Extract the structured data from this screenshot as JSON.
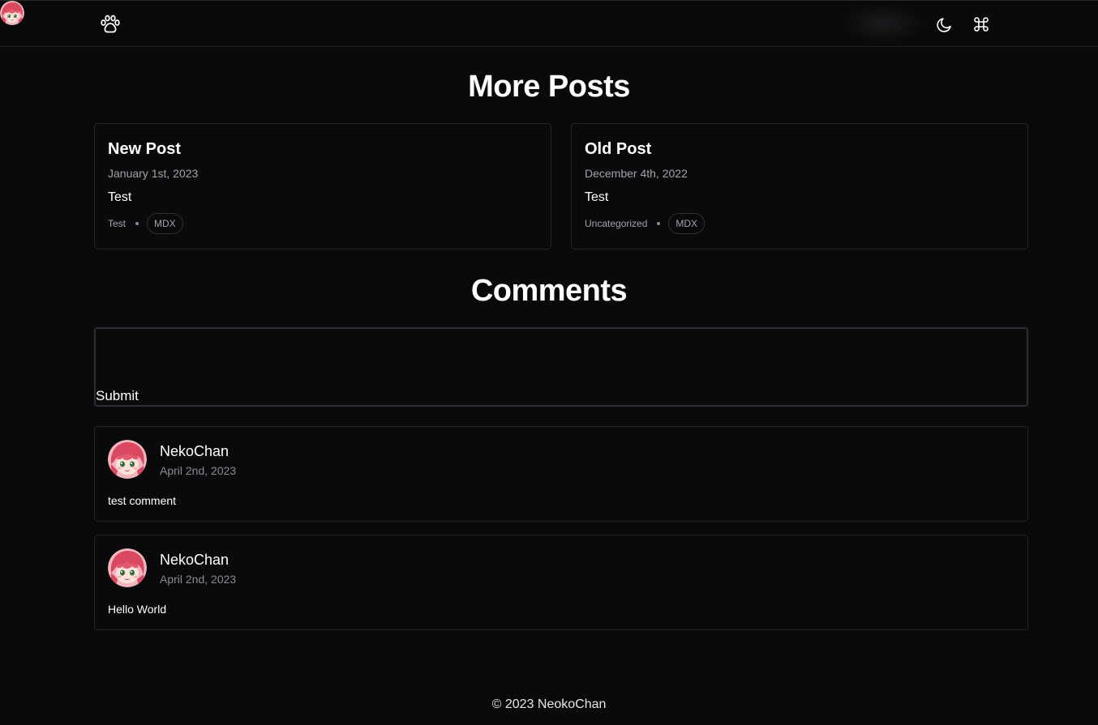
{
  "header": {
    "logo_icon": "paw-icon",
    "theme_toggle_icon": "moon-icon",
    "command_icon": "command-icon",
    "avatar_icon": "user-avatar"
  },
  "more_posts": {
    "title": "More Posts",
    "posts": [
      {
        "title": "New Post",
        "date": "January 1st, 2023",
        "excerpt": "Test",
        "category": "Test",
        "tag": "MDX"
      },
      {
        "title": "Old Post",
        "date": "December 4th, 2022",
        "excerpt": "Test",
        "category": "Uncategorized",
        "tag": "MDX"
      }
    ]
  },
  "comments": {
    "title": "Comments",
    "input_value": "",
    "submit_label": "Submit",
    "items": [
      {
        "author": "NekoChan",
        "date": "April 2nd, 2023",
        "body": "test comment"
      },
      {
        "author": "NekoChan",
        "date": "April 2nd, 2023",
        "body": "Hello World"
      }
    ]
  },
  "footer": {
    "text": "© 2023 NeokoChan"
  },
  "colors": {
    "background": "#0a0a0c",
    "border": "#26262a",
    "muted_text": "#a3a3a8",
    "avatar_pink": "#e8707f"
  }
}
